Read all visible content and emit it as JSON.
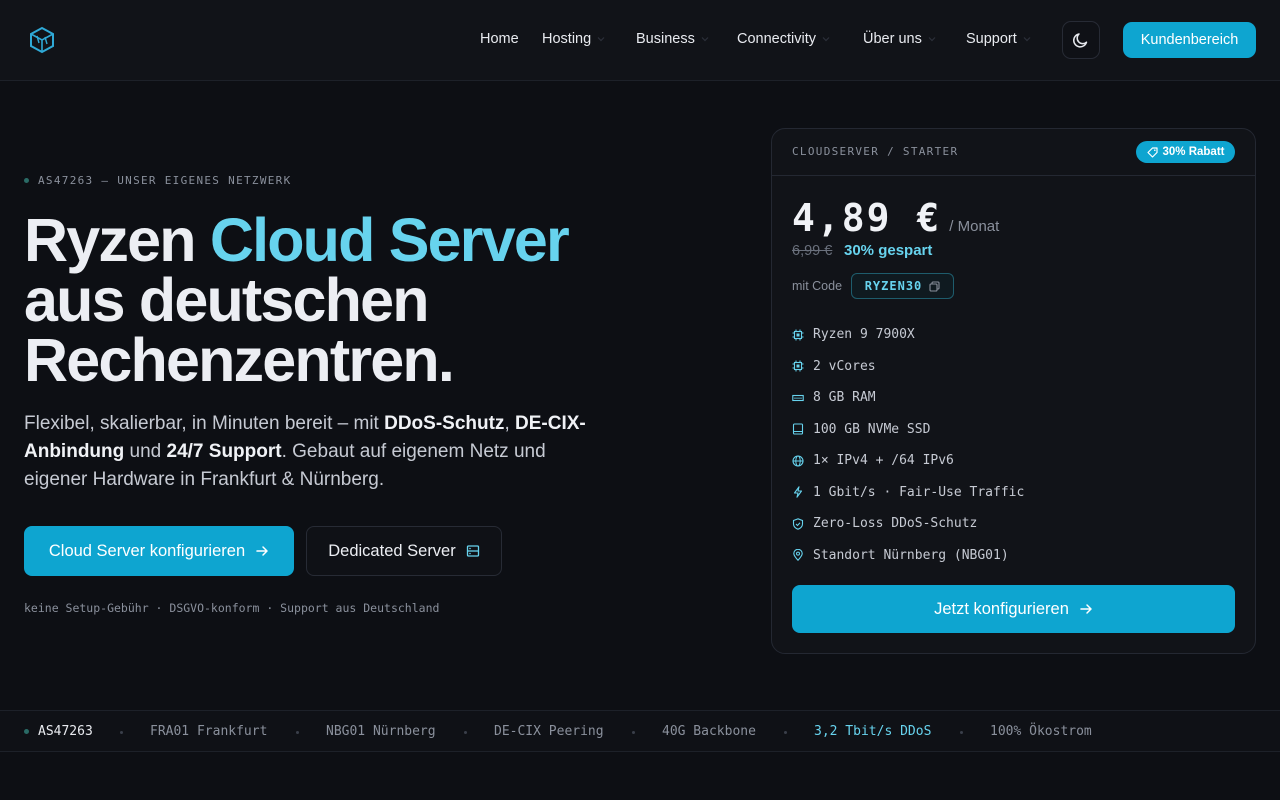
{
  "header": {
    "logo_icon": "cube-logo-icon",
    "nav": [
      {
        "label": "Home",
        "has_dropdown": false
      },
      {
        "label": "Hosting",
        "has_dropdown": true
      },
      {
        "label": "Business",
        "has_dropdown": true
      },
      {
        "label": "Connectivity",
        "has_dropdown": true
      },
      {
        "label": "Über uns",
        "has_dropdown": true
      },
      {
        "label": "Support",
        "has_dropdown": true
      }
    ],
    "theme_icon": "moon-icon",
    "cta_label": "Kundenbereich"
  },
  "hero": {
    "eyebrow": "AS47263 — UNSER EIGENES NETZWERK",
    "title_part1": "Ryzen ",
    "title_accent": "Cloud Server",
    "title_line2": "aus deutschen",
    "title_line3": "Rechenzentren.",
    "sub_1": "Flexibel, skalierbar, in Minuten bereit – mit ",
    "sub_b1": "DDoS-Schutz",
    "sub_2": ", ",
    "sub_b2": "DE-CIX-Anbindung",
    "sub_3": " und ",
    "sub_b3": "24/7 Support",
    "sub_4": ". Gebaut auf eigenem Netz und eigener Hardware in Frankfurt & Nürnberg.",
    "primary_button": "Cloud Server konfigurieren",
    "secondary_button": "Dedicated Server",
    "trust_line": "keine Setup-Gebühr · DSGVO-konform · Support aus Deutschland"
  },
  "card": {
    "label": "CLOUDSERVER / STARTER",
    "badge": "30% Rabatt",
    "price": "4,89 €",
    "period": "/ Monat",
    "old_price": "6,99 €",
    "saved": "30% gespart",
    "code_label": "mit Code",
    "code": "RYZEN30",
    "specs": [
      {
        "icon": "cpu-icon",
        "text": "Ryzen 9 7900X"
      },
      {
        "icon": "cpu-icon",
        "text": "2 vCores"
      },
      {
        "icon": "memory-icon",
        "text": "8 GB RAM"
      },
      {
        "icon": "disk-icon",
        "text": "100 GB NVMe SSD"
      },
      {
        "icon": "globe-icon",
        "text": "1× IPv4 + /64 IPv6"
      },
      {
        "icon": "bolt-icon",
        "text": "1 Gbit/s · Fair-Use Traffic"
      },
      {
        "icon": "shield-icon",
        "text": "Zero-Loss DDoS-Schutz"
      },
      {
        "icon": "location-pin-icon",
        "text": "Standort Nürnberg (NBG01)"
      }
    ],
    "cta": "Jetzt konfigurieren"
  },
  "ticker": {
    "items": [
      "AS47263",
      "FRA01 Frankfurt",
      "NBG01 Nürnberg",
      "DE-CIX Peering",
      "40G Backbone",
      "3,2 Tbit/s DDoS",
      "100% Ökostrom"
    ]
  },
  "colors": {
    "accent": "#0ea5d0",
    "accent_text": "#67d3ee",
    "background": "#0d0f14"
  }
}
